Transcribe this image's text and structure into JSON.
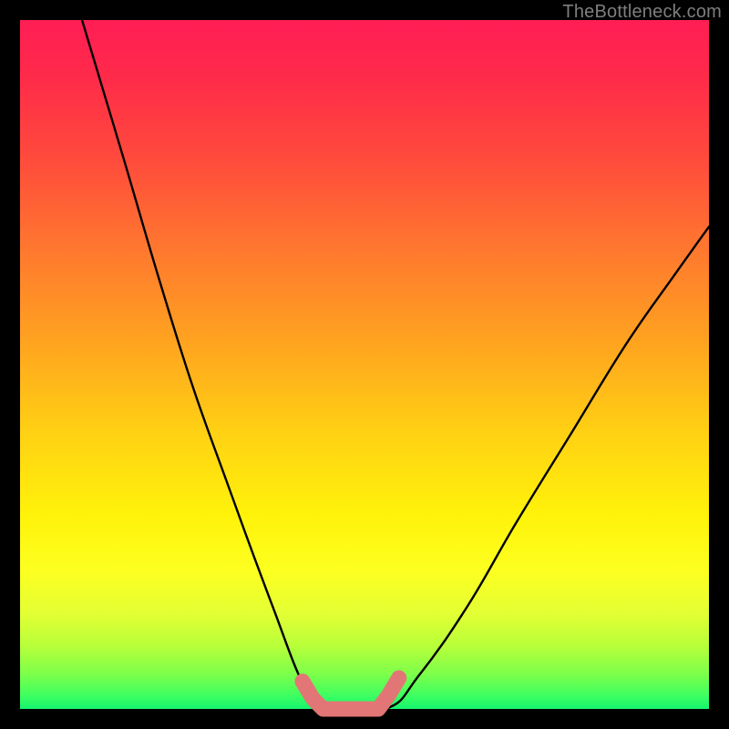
{
  "watermark": "TheBottleneck.com",
  "colors": {
    "background": "#000000",
    "gradient_top": "#ff1e55",
    "gradient_mid": "#fff30a",
    "gradient_bottom": "#14f56e",
    "curve": "#000000",
    "marker": "#e27676"
  },
  "chart_data": {
    "type": "line",
    "title": "",
    "xlabel": "",
    "ylabel": "",
    "xlim": [
      0,
      100
    ],
    "ylim": [
      0,
      100
    ],
    "series": [
      {
        "name": "left-curve",
        "x": [
          9,
          15,
          20,
          25,
          30,
          34,
          37,
          40,
          42,
          43.5
        ],
        "y": [
          100,
          80,
          63,
          47,
          33,
          22,
          14,
          6,
          2,
          0
        ]
      },
      {
        "name": "plateau",
        "x": [
          43.5,
          53
        ],
        "y": [
          0,
          0
        ]
      },
      {
        "name": "right-curve",
        "x": [
          53,
          58,
          65,
          72,
          80,
          88,
          95,
          100
        ],
        "y": [
          0,
          5,
          15,
          27,
          40,
          53,
          63,
          70
        ]
      }
    ],
    "markers": [
      {
        "name": "left-marker-top",
        "x": 41,
        "y": 4
      },
      {
        "name": "left-marker-mid",
        "x": 42.5,
        "y": 1.5
      },
      {
        "name": "left-marker-bottom",
        "x": 44,
        "y": 0
      },
      {
        "name": "plateau-marker-1",
        "x": 46,
        "y": 0
      },
      {
        "name": "plateau-marker-2",
        "x": 48,
        "y": 0
      },
      {
        "name": "plateau-marker-3",
        "x": 50,
        "y": 0
      },
      {
        "name": "right-marker-bottom",
        "x": 52,
        "y": 0
      },
      {
        "name": "right-marker-mid",
        "x": 53.5,
        "y": 2
      },
      {
        "name": "right-marker-top",
        "x": 55,
        "y": 4.5
      }
    ]
  }
}
